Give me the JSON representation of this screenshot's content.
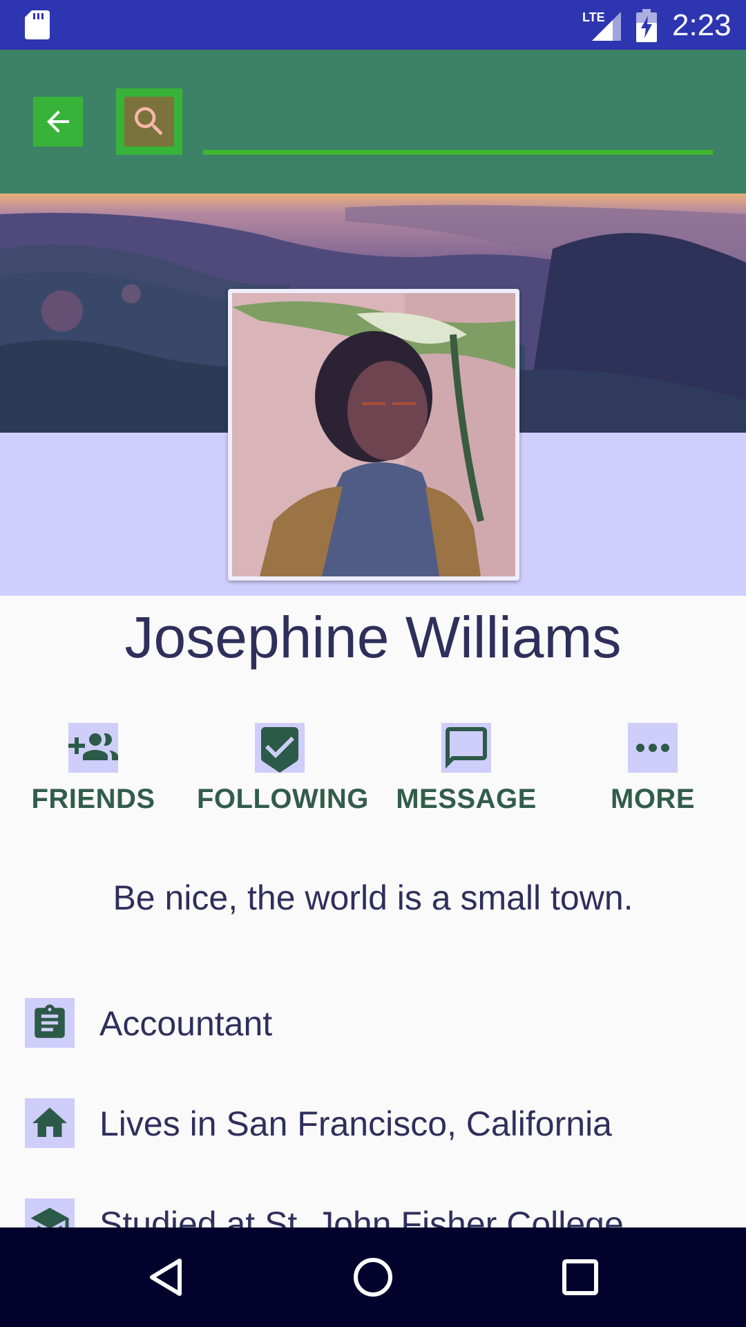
{
  "status_bar": {
    "time": "2:23",
    "network": "LTE"
  },
  "app_bar": {
    "search": {
      "value": "",
      "placeholder": ""
    }
  },
  "profile": {
    "name": "Josephine Williams",
    "bio": "Be nice, the world is a small town."
  },
  "actions": [
    {
      "label": "FRIENDS",
      "icon": "add-friends-icon"
    },
    {
      "label": "FOLLOWING",
      "icon": "following-check-icon"
    },
    {
      "label": "MESSAGE",
      "icon": "message-icon"
    },
    {
      "label": "MORE",
      "icon": "more-icon"
    }
  ],
  "details": [
    {
      "text": "Accountant",
      "icon": "clipboard-icon"
    },
    {
      "text": "Lives in San Francisco, California",
      "icon": "home-icon"
    },
    {
      "text": "Studied at St. John Fisher College",
      "icon": "school-icon"
    }
  ],
  "colors": {
    "status_bar": "#2d35b1",
    "app_bar": "#3d8267",
    "accent_green": "#38b33a",
    "hero_band": "#d0cefc",
    "icon_dark_green": "#2c5a48",
    "label_text": "#325c4b",
    "body_text": "#2f2f5c",
    "nav_bar": "#03022d"
  }
}
